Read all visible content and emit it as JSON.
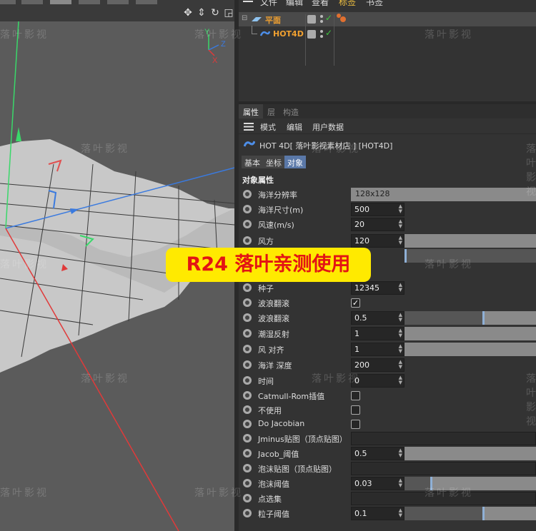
{
  "object_manager": {
    "menu": [
      "文件",
      "编辑",
      "查看",
      "标签",
      "书签"
    ],
    "objects": [
      {
        "name": "平面"
      },
      {
        "name": "HOT4D"
      }
    ]
  },
  "attribute_manager": {
    "tabs": [
      "属性",
      "层",
      "构造"
    ],
    "menu": [
      "模式",
      "编辑",
      "用户数据"
    ],
    "title": "HOT 4D[ 落叶影视素材店 ] [HOT4D]",
    "subtabs": [
      "基本",
      "坐标",
      "对象"
    ],
    "section": "对象属性",
    "props": {
      "p1": {
        "label": "海洋分辨率",
        "value": "128x128"
      },
      "p2": {
        "label": "海洋尺寸(m)",
        "value": "500"
      },
      "p3": {
        "label": "风速(m/s)",
        "value": "20"
      },
      "p4": {
        "label": "风方",
        "value": "120"
      },
      "p5": {
        "label": "种子",
        "value": "12345"
      },
      "p6": {
        "label": "波浪翻滚",
        "checked": true
      },
      "p7": {
        "label": "波浪翻滚",
        "value": "0.5",
        "level": 0.6
      },
      "p8": {
        "label": "潮湿反射",
        "value": "1"
      },
      "p9": {
        "label": "风 对齐",
        "value": "1"
      },
      "p10": {
        "label": "海洋 深度",
        "value": "200"
      },
      "p11": {
        "label": "时间",
        "value": "0"
      },
      "p12": {
        "label": "Catmull-Rom插值",
        "checked": false
      },
      "p13": {
        "label": "不使用",
        "checked": false
      },
      "p14": {
        "label": "Do Jacobian",
        "checked": false
      },
      "p15": {
        "label": "Jminus贴图（顶点贴图）"
      },
      "p16": {
        "label": "Jacob_阈值",
        "value": "0.5"
      },
      "p17": {
        "label": "泡沫贴图（顶点贴图）"
      },
      "p18": {
        "label": "泡沫阈值",
        "value": "0.03",
        "level": 0.2
      },
      "p19": {
        "label": "点选集"
      },
      "p20": {
        "label": "粒子阈值",
        "value": "0.1",
        "level": 0.6
      }
    }
  },
  "viewport": {
    "axis_labels": {
      "y": "Y",
      "z": "Z",
      "x": "X"
    },
    "colors": {
      "y_axis": "#3ad86a",
      "x_axis": "#e03a3a",
      "z_axis": "#3a7adf",
      "surface": "#c8c8c8",
      "background": "#5b5b5b"
    }
  },
  "banner": {
    "text": "R24 落叶亲测使用"
  },
  "watermark": {
    "text": "落叶影视"
  }
}
